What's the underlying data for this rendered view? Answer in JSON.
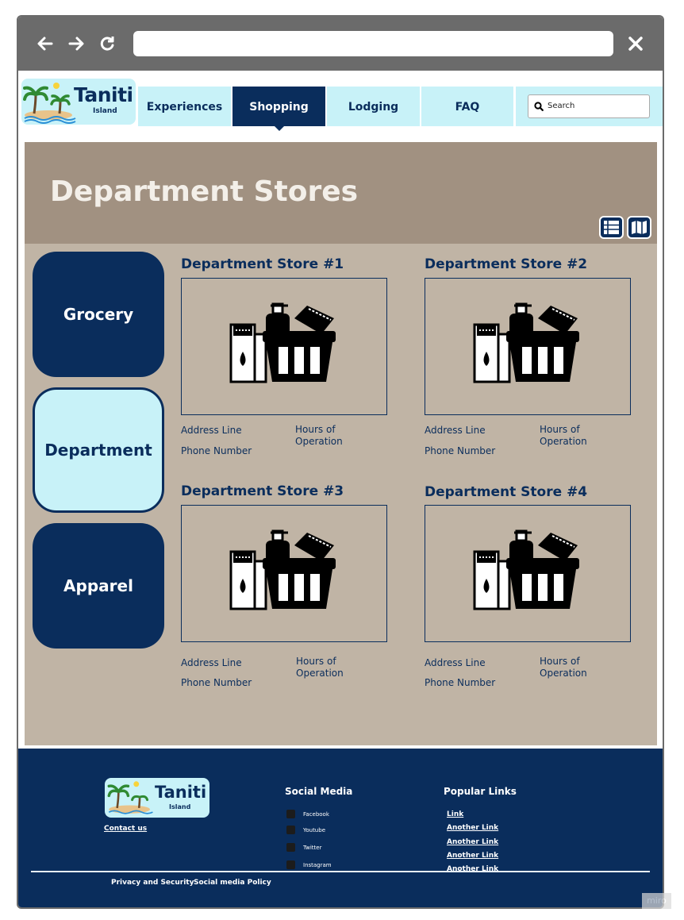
{
  "browser": {
    "back_icon": "arrow-left",
    "forward_icon": "arrow-right",
    "reload_icon": "reload",
    "close_icon": "x",
    "url": ""
  },
  "header": {
    "logo_text": "Taniti",
    "logo_sub": "Island",
    "tabs": [
      {
        "label": "Experiences",
        "active": false
      },
      {
        "label": "Shopping",
        "active": true
      },
      {
        "label": "Lodging",
        "active": false
      },
      {
        "label": "FAQ",
        "active": false
      }
    ],
    "search_placeholder": "Search"
  },
  "hero": {
    "title": "Department Stores",
    "list_view_icon": "list-view",
    "map_view_icon": "map-view"
  },
  "categories": [
    {
      "label": "Grocery",
      "active": false
    },
    {
      "label": "Department",
      "active": true
    },
    {
      "label": "Apparel",
      "active": false
    }
  ],
  "stores": [
    {
      "title": "Department Store #1",
      "address": "Address Line",
      "phone": "Phone Number",
      "hours": "Hours of\nOperation"
    },
    {
      "title": "Department Store #2",
      "address": "Address Line",
      "phone": "Phone Number",
      "hours": "Hours of\nOperation"
    },
    {
      "title": "Department Store #3",
      "address": "Address Line",
      "phone": "Phone Number",
      "hours": "Hours of\nOperation"
    },
    {
      "title": "Department Store #4",
      "address": "Address Line",
      "phone": "Phone Number",
      "hours": "Hours of\nOperation"
    }
  ],
  "footer": {
    "logo_text": "Taniti",
    "logo_sub": "Island",
    "contact": "Contact us",
    "social_heading": "Social Media",
    "social": [
      "Facebook",
      "Youtube",
      "Twitter",
      "Instagram"
    ],
    "popular_heading": "Popular Links",
    "links": [
      "Link",
      "Another Link",
      "Another Link",
      "Another Link",
      "Another Link"
    ],
    "privacy": "Privacy and Security",
    "social_policy": "Social media Policy"
  },
  "watermark": "miro",
  "colors": {
    "navy": "#0a2d5c",
    "light_cyan": "#c8f2f8",
    "hero_brown": "#a19181",
    "content_tan": "#c0b4a5"
  }
}
